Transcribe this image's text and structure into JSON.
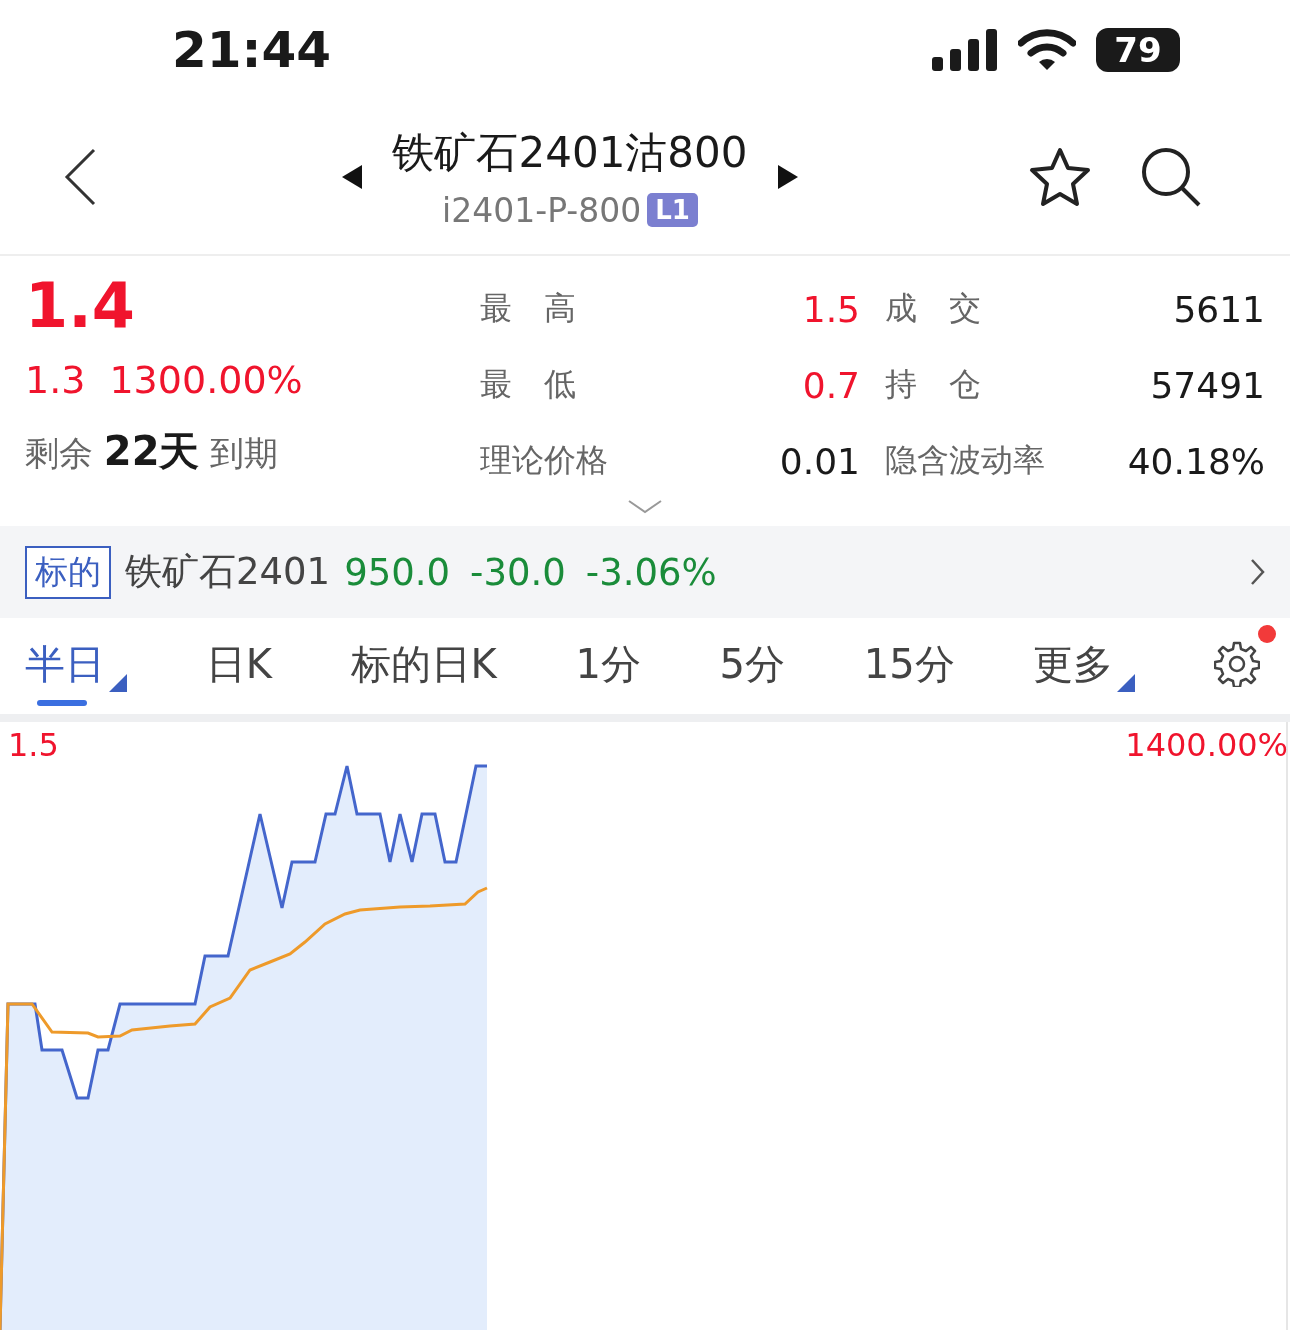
{
  "status_bar": {
    "time": "21:44",
    "battery": "79"
  },
  "header": {
    "title": "铁矿石2401沽800",
    "code": "i2401-P-800",
    "level_badge": "L1"
  },
  "quote": {
    "price": "1.4",
    "change": "1.3",
    "change_pct": "1300.00%",
    "expiry": "剩余 **22天** 到期"
  },
  "stats": [
    {
      "label": "最　高",
      "value": "1.5",
      "color": "#f0142d"
    },
    {
      "label": "成　交",
      "value": "5611",
      "color": "#1a1a1a"
    },
    {
      "label": "最　低",
      "value": "0.7",
      "color": "#f0142d"
    },
    {
      "label": "持　仓",
      "value": "57491",
      "color": "#1a1a1a"
    },
    {
      "label": "理论价格",
      "value": "0.01",
      "color": "#1a1a1a"
    },
    {
      "label": "隐含波动率",
      "value": "40.18%",
      "color": "#1a1a1a"
    }
  ],
  "underlying": {
    "tag": "标的",
    "name": "铁矿石2401",
    "price": "950.0",
    "change": "-30.0",
    "change_pct": "-3.06%",
    "color": "#1a8c3a"
  },
  "tabs": [
    {
      "label": "半日",
      "selected": true,
      "dropdown": true
    },
    {
      "label": "日K",
      "selected": false,
      "dropdown": false
    },
    {
      "label": "标的日K",
      "selected": false,
      "dropdown": false
    },
    {
      "label": "1分",
      "selected": false,
      "dropdown": false
    },
    {
      "label": "5分",
      "selected": false,
      "dropdown": false
    },
    {
      "label": "15分",
      "selected": false,
      "dropdown": false
    },
    {
      "label": "更多",
      "selected": false,
      "dropdown": true
    }
  ],
  "settings": {
    "notification_dot": true
  },
  "chart": {
    "top_left_label": "1.5",
    "top_right_label": "1400.00%"
  }
}
